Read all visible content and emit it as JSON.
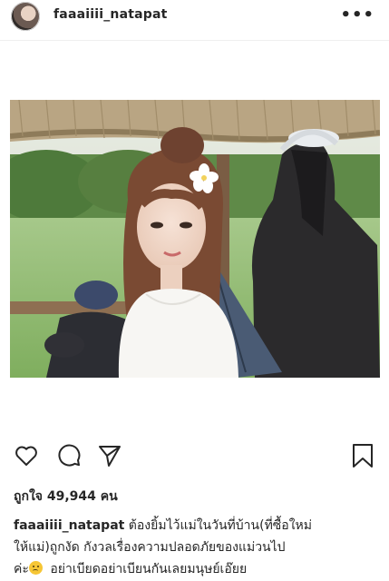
{
  "header": {
    "username": "faaaiiii_natapat",
    "more_label": "•••"
  },
  "post": {
    "likes_text": "ถูกใจ 49,944 คน",
    "caption": {
      "username": "faaaiiii_natapat",
      "line1": "ต้องยิ้มไว้แม่ในวันที่บ้าน(ที่ซื้อใหม่",
      "line2": "ให้แม่)ถูกงัด กังวลเรื่องความปลอดภัยของแม่วนไป",
      "line3_prefix": "ค่ะ",
      "line3_suffix": "อย่าเบียดอย่าเบียนกันเลยมนุษย์เอ๊ยย"
    }
  },
  "icons": {
    "heart": "heart-icon",
    "comment": "comment-icon",
    "share": "share-icon",
    "bookmark": "bookmark-icon",
    "emoji": "disappointed-face-emoji"
  },
  "colors": {
    "text": "#262626",
    "divider": "#efefef",
    "background": "#ffffff"
  }
}
